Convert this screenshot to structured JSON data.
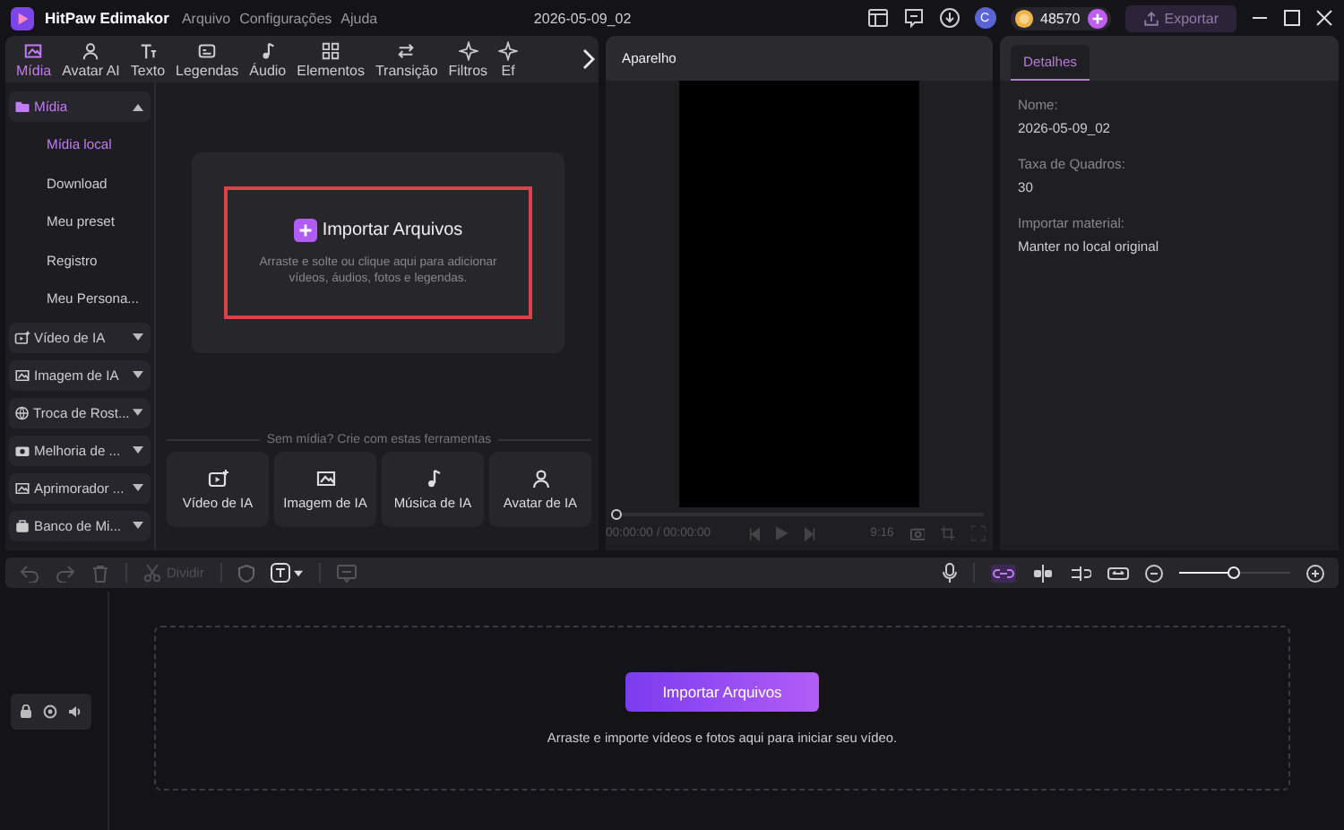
{
  "app": {
    "name": "HitPaw Edimakor"
  },
  "menu": [
    "Arquivo",
    "Configurações",
    "Ajuda"
  ],
  "project_title": "2026-05-09_02",
  "account": {
    "avatar_letter": "C",
    "coins": "48570"
  },
  "export_button": {
    "label": "Exportar",
    "disabled": true
  },
  "media_tabs": [
    {
      "label": "Mídia",
      "selected": true
    },
    {
      "label": "Avatar AI",
      "selected": false
    },
    {
      "label": "Texto",
      "selected": false
    },
    {
      "label": "Legendas",
      "selected": false
    },
    {
      "label": "Áudio",
      "selected": false
    },
    {
      "label": "Elementos",
      "selected": false
    },
    {
      "label": "Transição",
      "selected": false
    },
    {
      "label": "Filtros",
      "selected": false
    },
    {
      "label": "Ef",
      "selected": false
    }
  ],
  "sidebar": {
    "items": [
      {
        "kind": "group",
        "label": "Mídia",
        "expanded": true,
        "selected": true
      },
      {
        "kind": "sub",
        "label": "Mídia local",
        "selected": true
      },
      {
        "kind": "sub",
        "label": "Download",
        "selected": false
      },
      {
        "kind": "sub",
        "label": "Meu preset",
        "selected": false
      },
      {
        "kind": "sub",
        "label": "Registro",
        "selected": false
      },
      {
        "kind": "sub",
        "label": "Meu Persona...",
        "selected": false
      },
      {
        "kind": "group",
        "label": "Vídeo de IA",
        "expanded": false,
        "selected": false
      },
      {
        "kind": "group",
        "label": "Imagem de IA",
        "expanded": false,
        "selected": false
      },
      {
        "kind": "group",
        "label": "Troca de Rost...",
        "expanded": false,
        "selected": false
      },
      {
        "kind": "group",
        "label": "Melhoria de ...",
        "expanded": false,
        "selected": false
      },
      {
        "kind": "group",
        "label": "Aprimorador ...",
        "expanded": false,
        "selected": false
      },
      {
        "kind": "group",
        "label": "Banco de Mi...",
        "expanded": false,
        "selected": false
      }
    ]
  },
  "import_box": {
    "title": "Importar Arquivos",
    "hint": "Arraste e solte ou clique aqui para adicionar vídeos, áudios, fotos e legendas.",
    "highlighted": true
  },
  "tools": {
    "caption": "Sem mídia? Crie com estas ferramentas",
    "items": [
      "Vídeo de IA",
      "Imagem de IA",
      "Música de IA",
      "Avatar de IA"
    ]
  },
  "player": {
    "title": "Aparelho",
    "level": 0,
    "timecode": "00:00:00 / 00:00:00",
    "aspect": "9:16"
  },
  "details": {
    "tab": "Detalhes",
    "fields": [
      {
        "label": "Nome:",
        "value": "2026-05-09_02"
      },
      {
        "label": "Taxa de Quadros:",
        "value": "30"
      },
      {
        "label": "Importar material:",
        "value": "Manter no local original"
      }
    ]
  },
  "toolbar": {
    "split_label": "Dividir",
    "split_disabled": true,
    "zoom": {
      "level": 0.5
    }
  },
  "timeline": {
    "button": "Importar Arquivos",
    "hint": "Arraste e importe vídeos e fotos aqui para iniciar seu vídeo."
  }
}
